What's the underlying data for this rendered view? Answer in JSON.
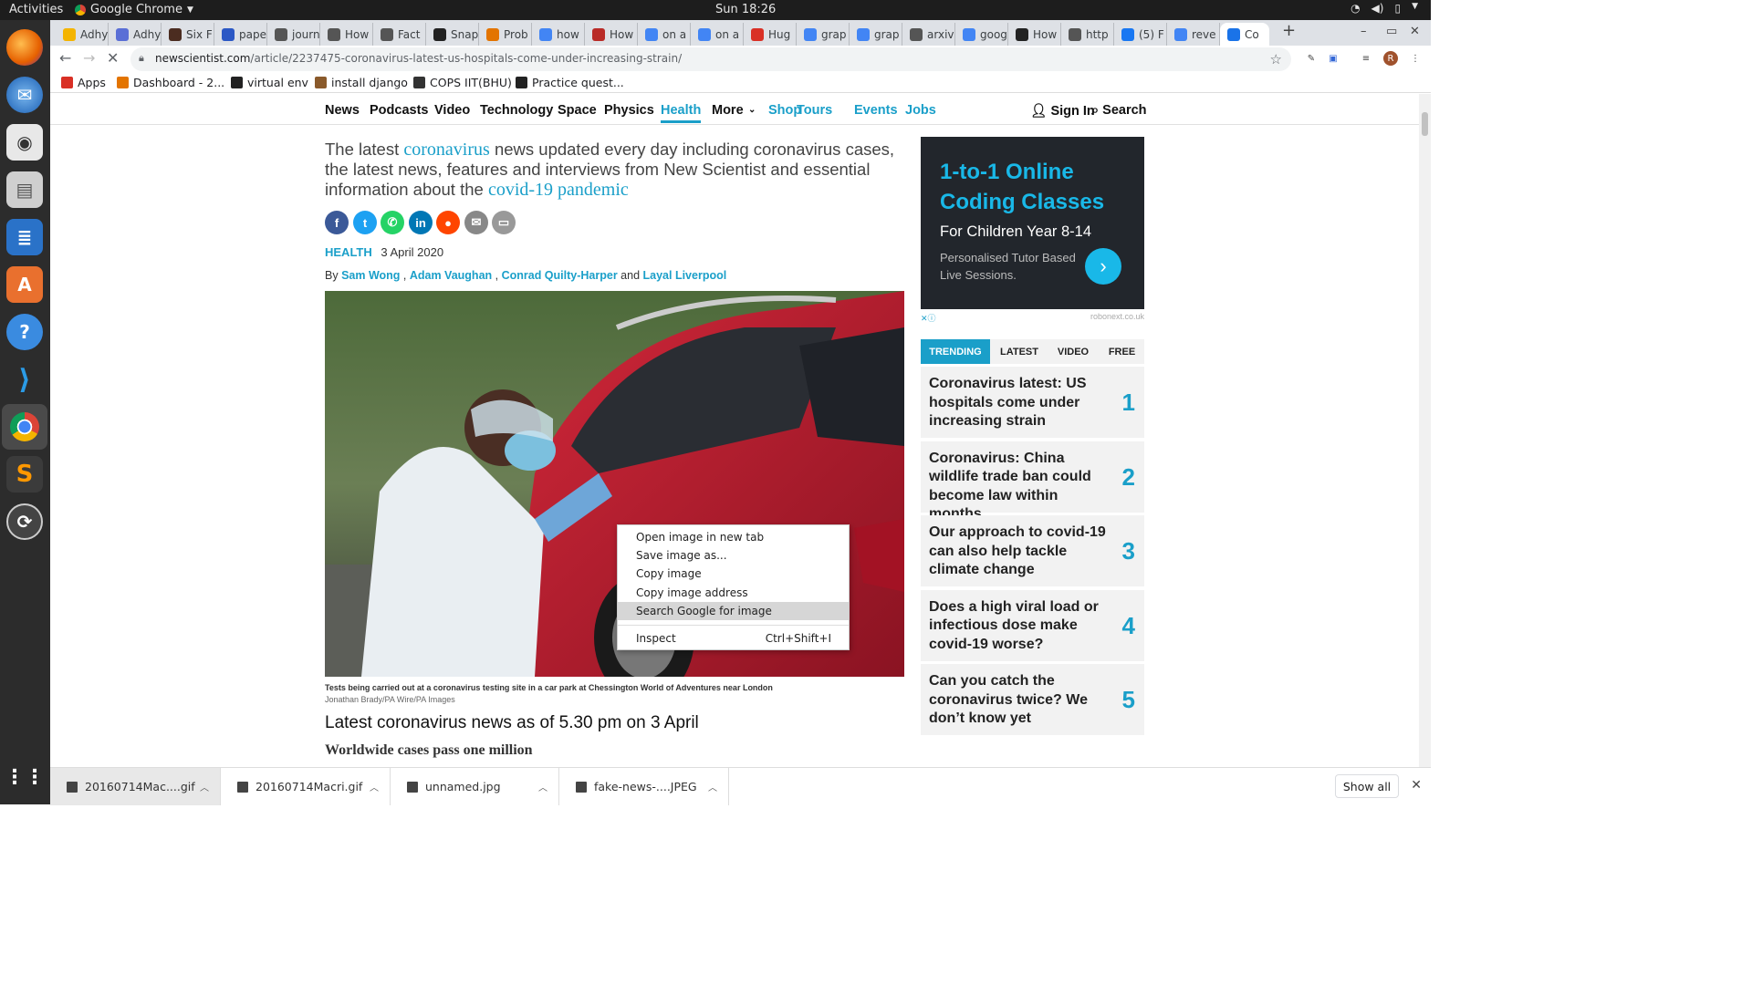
{
  "system": {
    "activities": "Activities",
    "app_name": "Google Chrome",
    "clock": "Sun 18:26"
  },
  "tabs": [
    {
      "label": "Adhy",
      "color": "#f4b400"
    },
    {
      "label": "Adhy",
      "color": "#5a6fd6"
    },
    {
      "label": "Six F",
      "color": "#4b2c20"
    },
    {
      "label": "pape",
      "color": "#2b58c5"
    },
    {
      "label": "journ",
      "color": "#555555"
    },
    {
      "label": "How",
      "color": "#555555"
    },
    {
      "label": "Fact",
      "color": "#555555"
    },
    {
      "label": "Snap",
      "color": "#222222"
    },
    {
      "label": "Prob",
      "color": "#e37400"
    },
    {
      "label": "how",
      "color": "#4285f4"
    },
    {
      "label": "How",
      "color": "#b92b27"
    },
    {
      "label": "on a",
      "color": "#4285f4"
    },
    {
      "label": "on a",
      "color": "#4285f4"
    },
    {
      "label": "Hug",
      "color": "#d93025"
    },
    {
      "label": "grap",
      "color": "#4285f4"
    },
    {
      "label": "grap",
      "color": "#4285f4"
    },
    {
      "label": "arxiv",
      "color": "#555555"
    },
    {
      "label": "goog",
      "color": "#4285f4"
    },
    {
      "label": "How",
      "color": "#222222"
    },
    {
      "label": "http",
      "color": "#555555"
    },
    {
      "label": "(5) F",
      "color": "#1877f2"
    },
    {
      "label": "reve",
      "color": "#4285f4"
    },
    {
      "label": "Co",
      "color": "#1a73e8",
      "active": true
    }
  ],
  "omnibox": {
    "domain": "newscientist.com",
    "path": "/article/2237475-coronavirus-latest-us-hospitals-come-under-increasing-strain/"
  },
  "bookmarks": [
    {
      "label": "Apps",
      "color": "#d93025"
    },
    {
      "label": "Dashboard - 2...",
      "color": "#e37400"
    },
    {
      "label": "virtual env",
      "color": "#222222"
    },
    {
      "label": "install django",
      "color": "#8a5a2b"
    },
    {
      "label": "COPS IIT(BHU)",
      "color": "#333333"
    },
    {
      "label": "Practice quest...",
      "color": "#222222"
    }
  ],
  "site_nav": {
    "items": [
      "News",
      "Podcasts",
      "Video",
      "Technology",
      "Space",
      "Physics",
      "Health",
      "More",
      "Shop",
      "Tours",
      "Events",
      "Jobs"
    ],
    "sign_in": "Sign In",
    "search": "Search"
  },
  "article": {
    "intro_1": "The latest ",
    "intro_link_1": "coronavirus",
    "intro_2": " news updated every day including coronavirus cases, the latest news, features and interviews from New Scientist and essential information about the ",
    "intro_link_2": "covid-19 pandemic",
    "section": "HEALTH",
    "date": "3 April 2020",
    "by": "By",
    "authors": [
      "Sam Wong",
      "Adam Vaughan",
      "Conrad Quilty-Harper",
      "Layal Liverpool"
    ],
    "and": "and",
    "caption": "Tests being carried out at a coronavirus testing site in a car park at Chessington World of Adventures near London",
    "credit": "Jonathan Brady/PA Wire/PA Images",
    "subhead": "Latest coronavirus news as of 5.30 pm on 3 April",
    "h3": "Worldwide cases pass one million"
  },
  "ad": {
    "title": "1-to-1 Online Coding Classes",
    "subtitle": "For Children Year 8-14",
    "body": "Personalised Tutor Based Live Sessions.",
    "source": "robonext.co.uk"
  },
  "trending": {
    "tabs": [
      "TRENDING",
      "LATEST",
      "VIDEO",
      "FREE"
    ],
    "items": [
      {
        "title": "Coronavirus latest: US hospitals come under increasing strain",
        "num": "1"
      },
      {
        "title": "Coronavirus: China wildlife trade ban could become law within months",
        "num": "2"
      },
      {
        "title": "Our approach to covid-19 can also help tackle climate change",
        "num": "3"
      },
      {
        "title": "Does a high viral load or infectious dose make covid-19 worse?",
        "num": "4"
      },
      {
        "title": "Can you catch the coronavirus twice? We don’t know yet",
        "num": "5"
      }
    ]
  },
  "context_menu": {
    "items": [
      "Open image in new tab",
      "Save image as...",
      "Copy image",
      "Copy image address",
      "Search Google for image",
      "Inspect"
    ],
    "inspect_shortcut": "Ctrl+Shift+I"
  },
  "downloads": {
    "files": [
      "20160714Mac....gif",
      "20160714Macri.gif",
      "unnamed.jpg",
      "fake-news-....JPEG"
    ],
    "show_all": "Show all"
  }
}
